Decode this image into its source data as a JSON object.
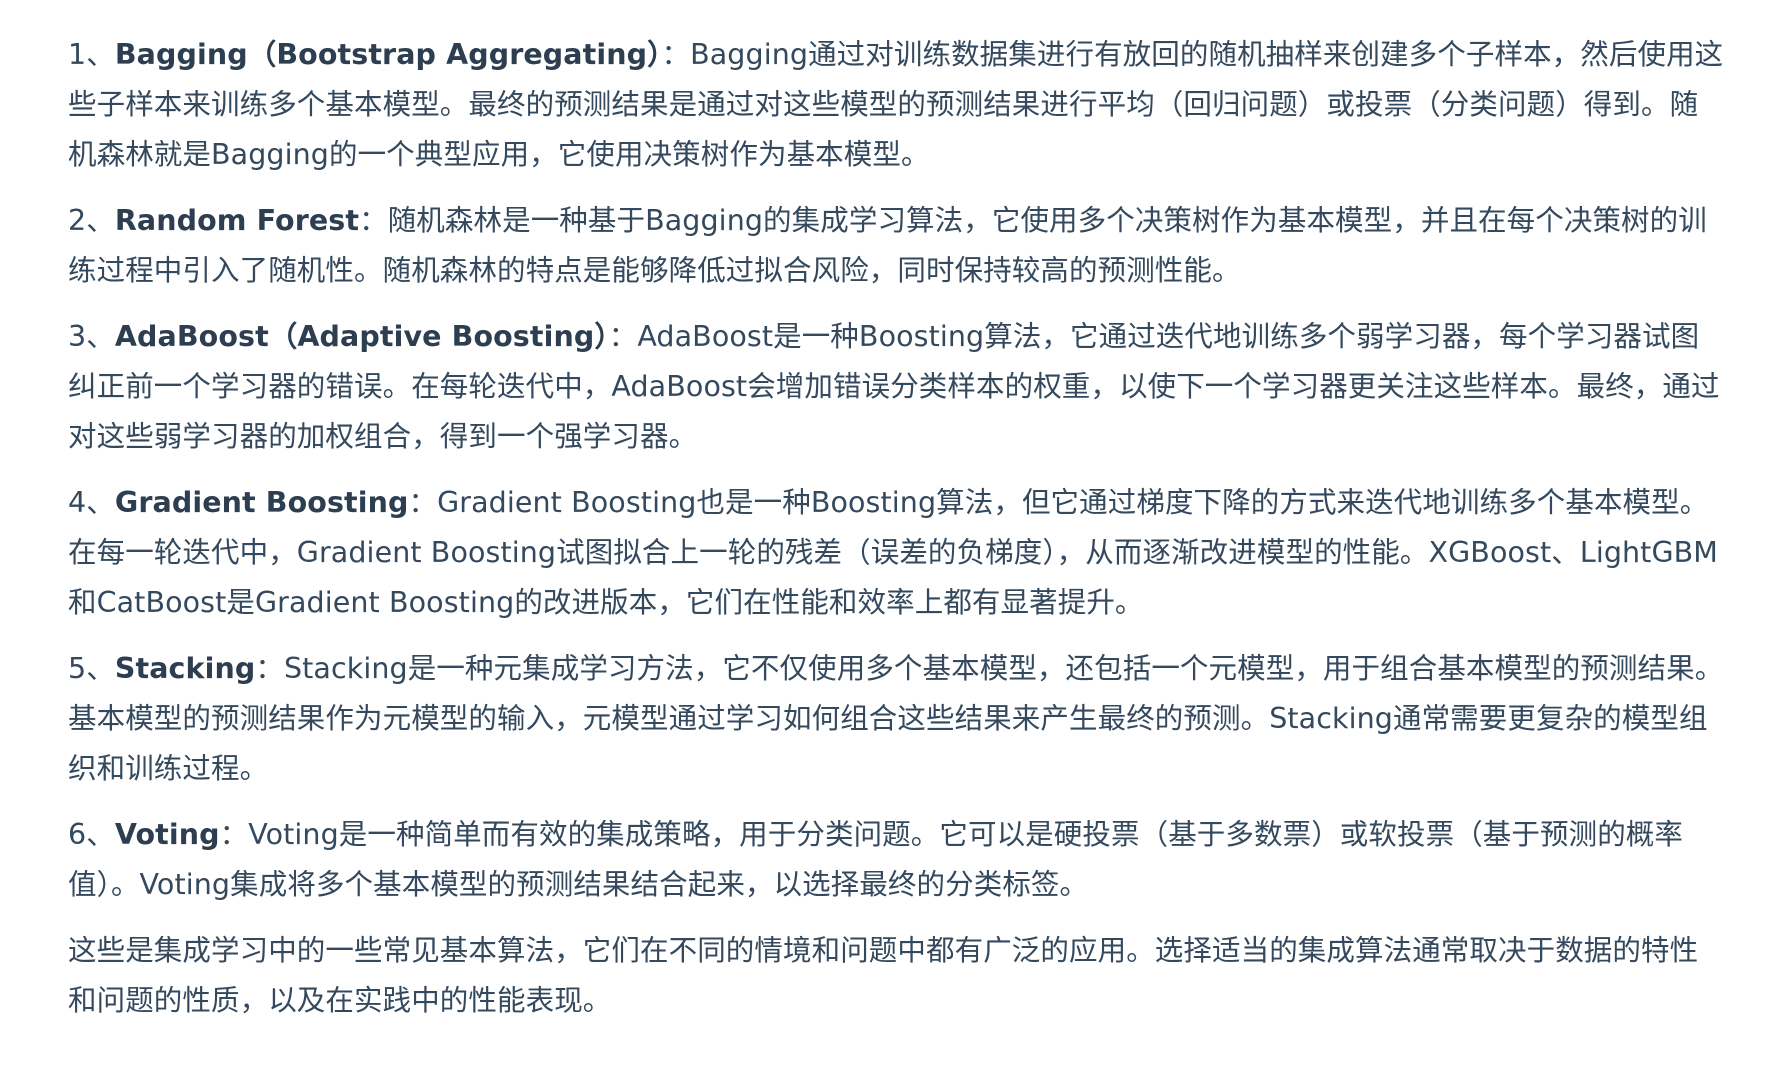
{
  "items": [
    {
      "number": "1、",
      "term": "Bagging（Bootstrap Aggregating）",
      "sep": "：",
      "text": "Bagging通过对训练数据集进行有放回的随机抽样来创建多个子样本，然后使用这些子样本来训练多个基本模型。最终的预测结果是通过对这些模型的预测结果进行平均（回归问题）或投票（分类问题）得到。随机森林就是Bagging的一个典型应用，它使用决策树作为基本模型。"
    },
    {
      "number": "2、",
      "term": "Random Forest",
      "sep": "：",
      "text": "随机森林是一种基于Bagging的集成学习算法，它使用多个决策树作为基本模型，并且在每个决策树的训练过程中引入了随机性。随机森林的特点是能够降低过拟合风险，同时保持较高的预测性能。"
    },
    {
      "number": "3、",
      "term": "AdaBoost（Adaptive Boosting）",
      "sep": "：",
      "text": "AdaBoost是一种Boosting算法，它通过迭代地训练多个弱学习器，每个学习器试图纠正前一个学习器的错误。在每轮迭代中，AdaBoost会增加错误分类样本的权重，以使下一个学习器更关注这些样本。最终，通过对这些弱学习器的加权组合，得到一个强学习器。"
    },
    {
      "number": "4、",
      "term": "Gradient Boosting",
      "sep": "：",
      "text": "Gradient Boosting也是一种Boosting算法，但它通过梯度下降的方式来迭代地训练多个基本模型。在每一轮迭代中，Gradient Boosting试图拟合上一轮的残差（误差的负梯度），从而逐渐改进模型的性能。XGBoost、LightGBM和CatBoost是Gradient Boosting的改进版本，它们在性能和效率上都有显著提升。"
    },
    {
      "number": "5、",
      "term": "Stacking",
      "sep": "：",
      "text": "Stacking是一种元集成学习方法，它不仅使用多个基本模型，还包括一个元模型，用于组合基本模型的预测结果。基本模型的预测结果作为元模型的输入，元模型通过学习如何组合这些结果来产生最终的预测。Stacking通常需要更复杂的模型组织和训练过程。"
    },
    {
      "number": "6、",
      "term": "Voting",
      "sep": "：",
      "text": "Voting是一种简单而有效的集成策略，用于分类问题。它可以是硬投票（基于多数票）或软投票（基于预测的概率值）。Voting集成将多个基本模型的预测结果结合起来，以选择最终的分类标签。"
    }
  ],
  "conclusion": "这些是集成学习中的一些常见基本算法，它们在不同的情境和问题中都有广泛的应用。选择适当的集成算法通常取决于数据的特性和问题的性质，以及在实践中的性能表现。"
}
